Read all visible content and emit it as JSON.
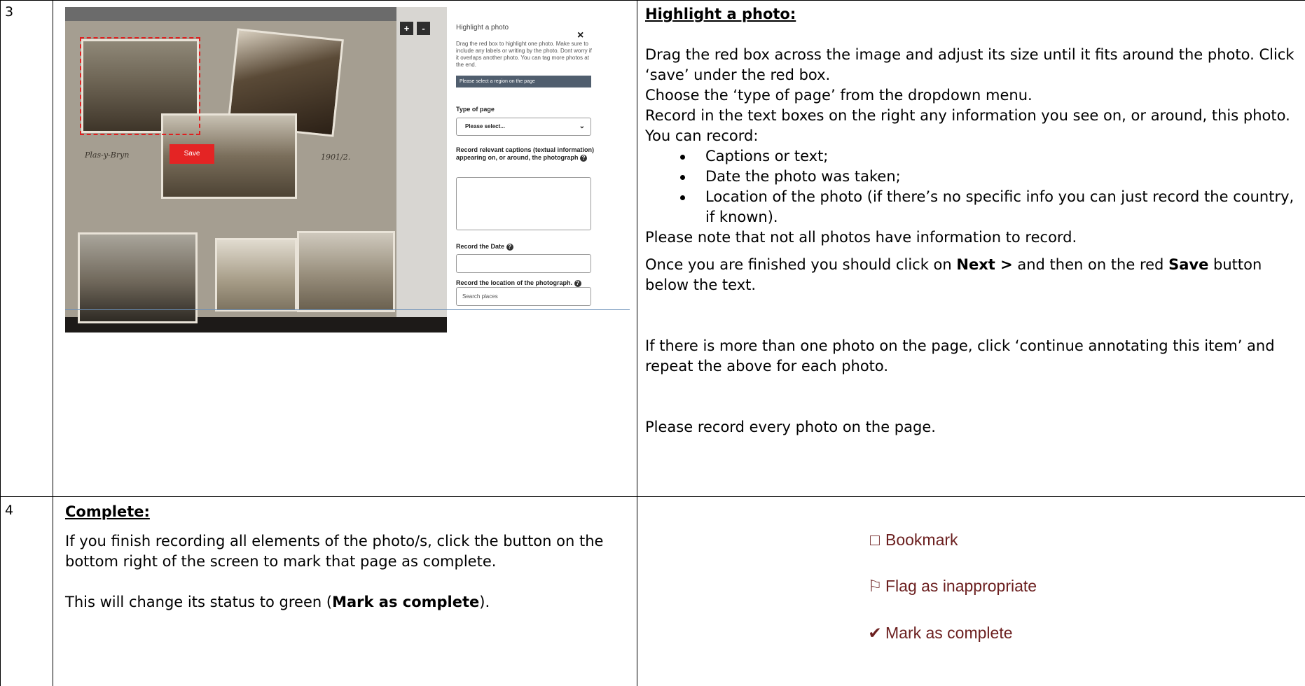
{
  "row3": {
    "number": "3",
    "heading": "Highlight a photo:",
    "p1": "Drag the red box across the image and adjust its size until it fits around the photo. Click ‘save’ under the red box.",
    "p2": "Choose the ‘type of page’ from the dropdown menu.",
    "p3": "Record in the text boxes on the right any information you see on, or around, this photo.  You can record:",
    "bullets": [
      "Captions or text;",
      "Date the photo was taken;",
      "Location of the photo (if there’s no specific info you can just record the country, if known)."
    ],
    "p4": "Please note that not all photos have information to record.",
    "p5_pre": "Once you are finished you should click on ",
    "p5_next": "Next >",
    "p5_mid": " and then on the red ",
    "p5_save": "Save",
    "p5_post": " button below the text.",
    "p6": "If there is more than one photo on the page, click ‘continue annotating this item’ and repeat the above for each photo.",
    "p7": "Please record every photo on the page."
  },
  "screenshot": {
    "zoom_in": "+",
    "zoom_out": "-",
    "save_label": "Save",
    "caption_left": "Plas-y-Bryn",
    "caption_right": "1901/2.",
    "panel_title": "Highlight a photo",
    "close": "×",
    "panel_desc": "Drag the red box to highlight one photo. Make sure to include any labels or writing by the photo. Dont worry if it overlaps another photo. You can tag more photos at the end.",
    "region_bar": "Please select a region on the page",
    "type_label": "Type of page",
    "type_value": "Please select...",
    "captions_label": "Record relevant captions (textual information) appearing on, or around, the photograph",
    "date_label": "Record the Date",
    "location_label": "Record the location of the photograph.",
    "location_placeholder": "Search places"
  },
  "row4": {
    "number": "4",
    "heading": "Complete:",
    "p1": "If you finish recording all elements of the photo/s, click the button on the bottom right of the screen to mark that page as complete.",
    "p2_pre": "This will change its status to green (",
    "p2_bold": "Mark as complete",
    "p2_post": ").",
    "actions": [
      {
        "label": "Bookmark",
        "icon": "bookmark-icon"
      },
      {
        "label": "Flag as inappropriate",
        "icon": "flag-icon"
      },
      {
        "label": "Mark as complete",
        "icon": "check-icon"
      }
    ]
  },
  "colors": {
    "save_red": "#e42424",
    "action_text": "#6b1f1f",
    "region_bar": "#505e6e"
  }
}
